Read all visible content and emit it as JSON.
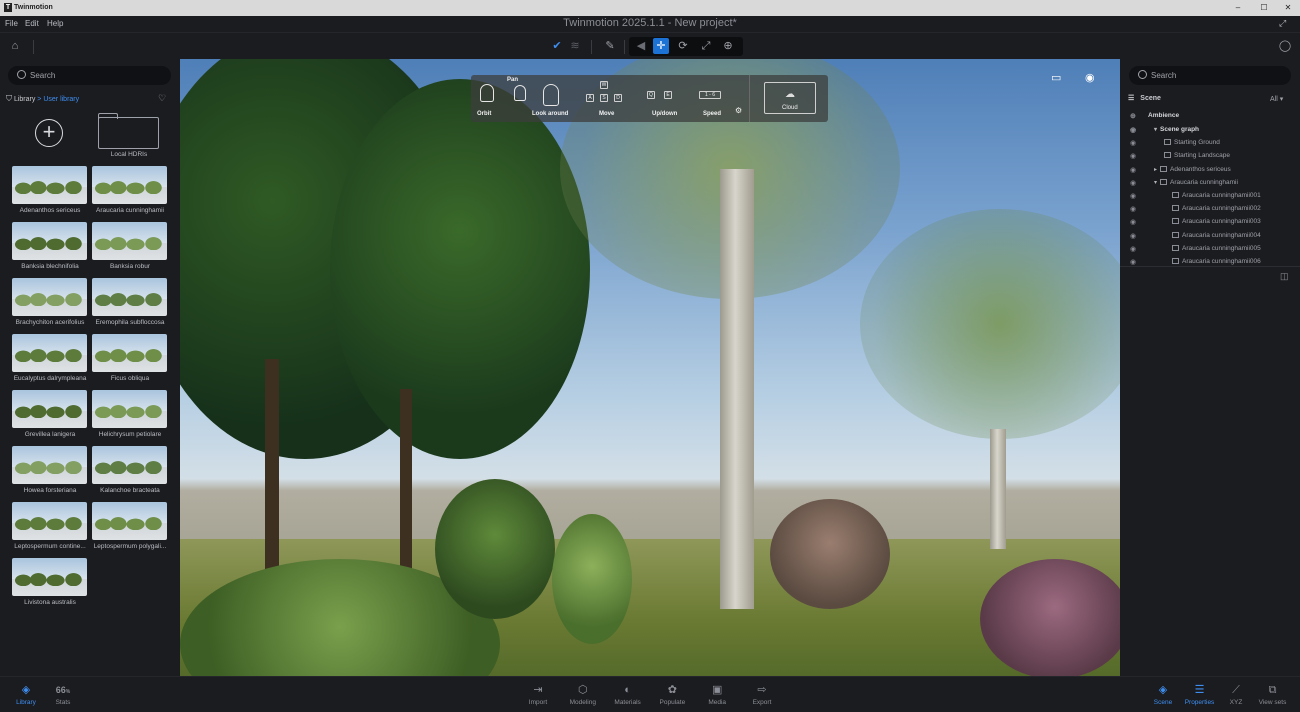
{
  "window": {
    "app_name": "Twinmotion",
    "logo_letter": "T",
    "minimize": "–",
    "maximize": "☐",
    "close": "✕"
  },
  "menu": {
    "items": [
      "File",
      "Edit",
      "Help"
    ],
    "document_title": "Twinmotion 2025.1.1 - New project*"
  },
  "toolbar": {
    "home_icon": "⌂",
    "user_icon": "◯"
  },
  "library": {
    "search_placeholder": "Search",
    "breadcrumb_root": "Library",
    "breadcrumb_sep": " > ",
    "breadcrumb_current": "User library",
    "add_symbol": "+",
    "folder_label": "Local HDRIs",
    "items": [
      "Adenanthos sericeus",
      "Araucaria cunninghamii",
      "Banksia blechnifolia",
      "Banksia robur",
      "Brachychiton acerifolius",
      "Eremophila subfloccosa",
      "Eucalyptus dalrympleana",
      "Ficus obliqua",
      "Grevillea lanigera",
      "Helichrysum petiolare",
      "Howea forsteriana",
      "Kalanchoe bracteata",
      "Leptospermum contine...",
      "Leptospermum polygali...",
      "Livistona australis"
    ]
  },
  "nav_hud": {
    "pan": "Pan",
    "orbit": "Orbit",
    "look_around": "Look around",
    "move": "Move",
    "up_down": "Up/down",
    "speed": "Speed",
    "speed_value": "1 - 6",
    "cloud": "Cloud",
    "keys_move": [
      "W",
      "A",
      "S",
      "D"
    ],
    "keys_updown": [
      "Q",
      "E"
    ]
  },
  "scene": {
    "search_placeholder": "Search",
    "title": "Scene",
    "filter": "All",
    "ambience": "Ambience",
    "scene_graph": "Scene graph",
    "items": [
      "Starting Ground",
      "Starting Landscape",
      "Adenanthos sericeus",
      "Araucaria cunninghamii",
      "Araucaria cunninghamii001",
      "Araucaria cunninghamii002",
      "Araucaria cunninghamii003",
      "Araucaria cunninghamii004",
      "Araucaria cunninghamii005",
      "Araucaria cunninghamii006"
    ]
  },
  "bottom_left": [
    {
      "label": "Library",
      "icon": "◈"
    },
    {
      "label": "Stats",
      "icon": "66"
    }
  ],
  "stats_unit": "%",
  "bottom_center": [
    {
      "label": "Import",
      "icon": "⇥"
    },
    {
      "label": "Modeling",
      "icon": "⬡"
    },
    {
      "label": "Materials",
      "icon": "◐"
    },
    {
      "label": "Populate",
      "icon": "✿"
    },
    {
      "label": "Media",
      "icon": "▣"
    },
    {
      "label": "Export",
      "icon": "⇨"
    }
  ],
  "bottom_right": [
    {
      "label": "Scene",
      "icon": "◈"
    },
    {
      "label": "Properties",
      "icon": "☰"
    },
    {
      "label": "XYZ",
      "icon": "⟋"
    },
    {
      "label": "View sets",
      "icon": "⧉"
    }
  ],
  "colors": {
    "accent": "#3e8ef0",
    "toolbar_selected": "#1d72d6",
    "panel_bg": "#1b1c20"
  }
}
